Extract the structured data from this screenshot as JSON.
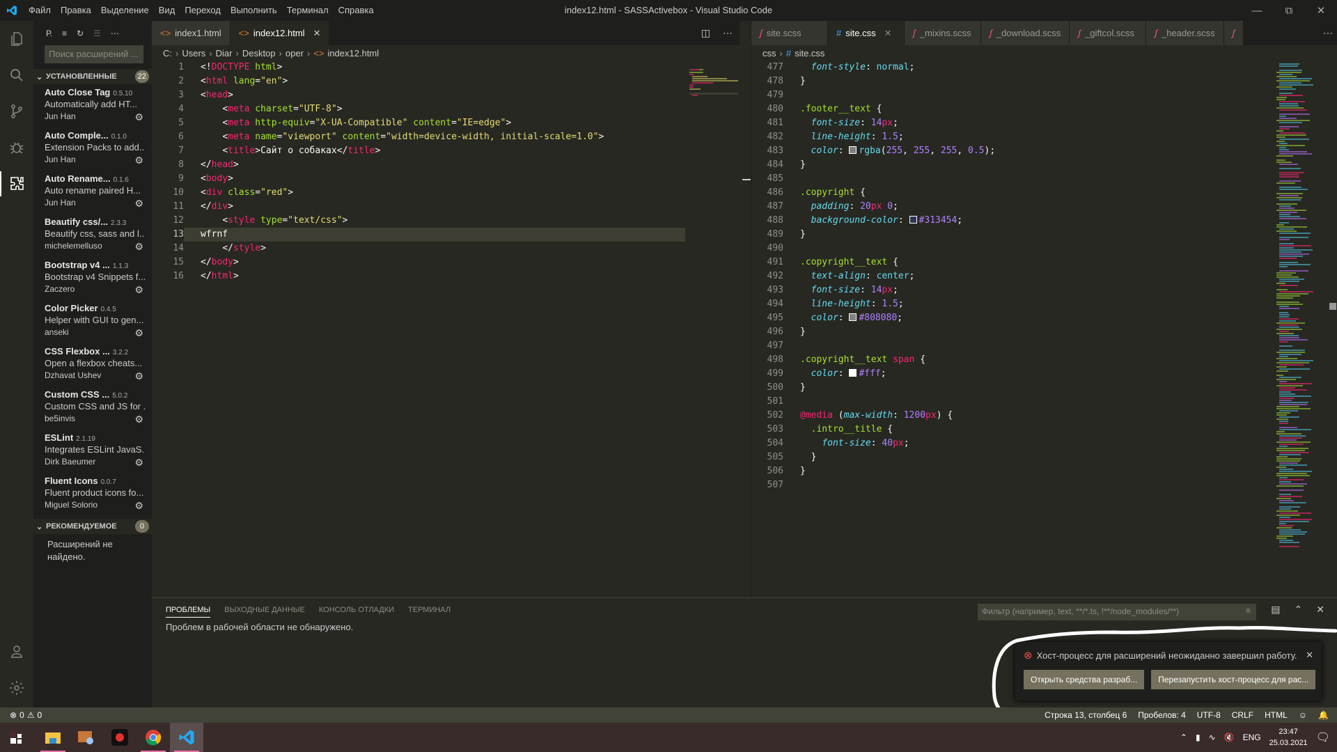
{
  "window": {
    "title": "index12.html - SASSActivebox - Visual Studio Code",
    "menu": [
      "Файл",
      "Правка",
      "Выделение",
      "Вид",
      "Переход",
      "Выполнить",
      "Терминал",
      "Справка"
    ]
  },
  "sidebar": {
    "header_label": "Р.",
    "search_placeholder": "Поиск расширений ...",
    "installed": {
      "title": "УСТАНОВЛЕННЫЕ",
      "count": "22",
      "items": [
        {
          "name": "Auto Close Tag",
          "version": "0.5.10",
          "desc": "Automatically add HT...",
          "author": "Jun Han"
        },
        {
          "name": "Auto Comple...",
          "version": "0.1.0",
          "desc": "Extension Packs to add...",
          "author": "Jun Han"
        },
        {
          "name": "Auto Rename...",
          "version": "0.1.6",
          "desc": "Auto rename paired H...",
          "author": "Jun Han"
        },
        {
          "name": "Beautify css/...",
          "version": "2.3.3",
          "desc": "Beautify css, sass and l...",
          "author": "michelemelluso"
        },
        {
          "name": "Bootstrap v4 ...",
          "version": "1.1.3",
          "desc": "Bootstrap v4 Snippets f...",
          "author": "Zaczero"
        },
        {
          "name": "Color Picker",
          "version": "0.4.5",
          "desc": "Helper with GUI to gen...",
          "author": "anseki"
        },
        {
          "name": "CSS Flexbox ...",
          "version": "3.2.2",
          "desc": "Open a flexbox cheats...",
          "author": "Dzhavat Ushev"
        },
        {
          "name": "Custom CSS ...",
          "version": "5.0.2",
          "desc": "Custom CSS and JS for ...",
          "author": "be5invis"
        },
        {
          "name": "ESLint",
          "version": "2.1.19",
          "desc": "Integrates ESLint JavaS...",
          "author": "Dirk Baeumer"
        },
        {
          "name": "Fluent Icons",
          "version": "0.0.7",
          "desc": "Fluent product icons fo...",
          "author": "Miguel Solorio"
        }
      ]
    },
    "recommended": {
      "title": "РЕКОМЕНДУЕМОЕ",
      "count": "0",
      "empty": "Расширений не найдено."
    }
  },
  "editor_left": {
    "tabs": [
      {
        "label": "index1.html",
        "active": false
      },
      {
        "label": "index12.html",
        "active": true
      }
    ],
    "breadcrumb": [
      "C:",
      "Users",
      "Diar",
      "Desktop",
      "oper",
      "index12.html"
    ],
    "current_line": 13,
    "lines": [
      {
        "n": "1",
        "html": "<span class='t-p'>&lt;!</span><span class='t-tag'>DOCTYPE</span> <span class='t-attr'>html</span><span class='t-p'>&gt;</span>"
      },
      {
        "n": "2",
        "html": "<span class='t-p'>&lt;</span><span class='t-tag'>html</span> <span class='t-attr'>lang</span><span class='t-p'>=</span><span class='t-str'>\"en\"</span><span class='t-p'>&gt;</span>"
      },
      {
        "n": "3",
        "html": "<span class='t-p'>&lt;</span><span class='t-tag'>head</span><span class='t-p'>&gt;</span>"
      },
      {
        "n": "4",
        "html": "    <span class='t-p'>&lt;</span><span class='t-tag'>meta</span> <span class='t-attr'>charset</span><span class='t-p'>=</span><span class='t-str'>\"UTF-8\"</span><span class='t-p'>&gt;</span>"
      },
      {
        "n": "5",
        "html": "    <span class='t-p'>&lt;</span><span class='t-tag'>meta</span> <span class='t-attr'>http-equiv</span><span class='t-p'>=</span><span class='t-str'>\"X-UA-Compatible\"</span> <span class='t-attr'>content</span><span class='t-p'>=</span><span class='t-str'>\"IE=edge\"</span><span class='t-p'>&gt;</span>"
      },
      {
        "n": "6",
        "html": "    <span class='t-p'>&lt;</span><span class='t-tag'>meta</span> <span class='t-attr'>name</span><span class='t-p'>=</span><span class='t-str'>\"viewport\"</span> <span class='t-attr'>content</span><span class='t-p'>=</span><span class='t-str'>\"width=device-width, initial-scale=1.0\"</span><span class='t-p'>&gt;</span>"
      },
      {
        "n": "7",
        "html": "    <span class='t-p'>&lt;</span><span class='t-tag'>title</span><span class='t-p'>&gt;</span><span class='t-txt'>Сайт о собаках</span><span class='t-p'>&lt;/</span><span class='t-tag'>title</span><span class='t-p'>&gt;</span>"
      },
      {
        "n": "8",
        "html": "<span class='t-p'>&lt;/</span><span class='t-tag'>head</span><span class='t-p'>&gt;</span>"
      },
      {
        "n": "9",
        "html": "<span class='t-p'>&lt;</span><span class='t-tag'>body</span><span class='t-p'>&gt;</span>"
      },
      {
        "n": "10",
        "html": "<span class='t-p'>&lt;</span><span class='t-tag'>div</span> <span class='t-attr'>class</span><span class='t-p'>=</span><span class='t-str'>\"red\"</span><span class='t-p'>&gt;</span>"
      },
      {
        "n": "11",
        "html": "<span class='t-p'>&lt;/</span><span class='t-tag'>div</span><span class='t-p'>&gt;</span>"
      },
      {
        "n": "12",
        "html": "    <span class='t-p'>&lt;</span><span class='t-tag'>style</span> <span class='t-attr'>type</span><span class='t-p'>=</span><span class='t-str'>\"text/css\"</span><span class='t-p'>&gt;</span>"
      },
      {
        "n": "13",
        "html": "<span class='t-txt'>wfrnf</span>"
      },
      {
        "n": "14",
        "html": "    <span class='t-p'>&lt;/</span><span class='t-tag'>style</span><span class='t-p'>&gt;</span>"
      },
      {
        "n": "15",
        "html": "<span class='t-p'>&lt;/</span><span class='t-tag'>body</span><span class='t-p'>&gt;</span>"
      },
      {
        "n": "16",
        "html": "<span class='t-p'>&lt;/</span><span class='t-tag'>html</span><span class='t-p'>&gt;</span>"
      }
    ]
  },
  "editor_right": {
    "tabs": [
      {
        "label": "site.scss",
        "type": "scss",
        "active": false
      },
      {
        "label": "site.css",
        "type": "css",
        "active": true
      },
      {
        "label": "_mixins.scss",
        "type": "scss",
        "active": false
      },
      {
        "label": "_download.scss",
        "type": "scss",
        "active": false
      },
      {
        "label": "_giftcol.scss",
        "type": "scss",
        "active": false
      },
      {
        "label": "_header.scss",
        "type": "scss",
        "active": false
      }
    ],
    "breadcrumb": [
      "css",
      "site.css"
    ],
    "lines": [
      {
        "n": "477",
        "html": "  <span class='t-prop'>font-style</span><span class='t-p'>: </span><span class='t-val'>normal</span><span class='t-p'>;</span>"
      },
      {
        "n": "478",
        "html": "<span class='t-p'>}</span>"
      },
      {
        "n": "479",
        "html": ""
      },
      {
        "n": "480",
        "html": "<span class='t-sel'>.footer__text</span> <span class='t-p'>{</span>"
      },
      {
        "n": "481",
        "html": "  <span class='t-prop'>font-size</span><span class='t-p'>: </span><span class='t-num'>14</span><span class='t-unit'>px</span><span class='t-p'>;</span>"
      },
      {
        "n": "482",
        "html": "  <span class='t-prop'>line-height</span><span class='t-p'>: </span><span class='t-num'>1.5</span><span class='t-p'>;</span>"
      },
      {
        "n": "483",
        "html": "  <span class='t-prop'>color</span><span class='t-p'>: </span><span class='swatch' style='background:#808080'></span><span class='t-val'>rgba</span><span class='t-p'>(</span><span class='t-num'>255</span><span class='t-p'>, </span><span class='t-num'>255</span><span class='t-p'>, </span><span class='t-num'>255</span><span class='t-p'>, </span><span class='t-num'>0.5</span><span class='t-p'>);</span>"
      },
      {
        "n": "484",
        "html": "<span class='t-p'>}</span>"
      },
      {
        "n": "485",
        "html": ""
      },
      {
        "n": "486",
        "html": "<span class='t-sel'>.copyright</span> <span class='t-p'>{</span>"
      },
      {
        "n": "487",
        "html": "  <span class='t-prop'>padding</span><span class='t-p'>: </span><span class='t-num'>20</span><span class='t-unit'>px</span> <span class='t-num'>0</span><span class='t-p'>;</span>"
      },
      {
        "n": "488",
        "html": "  <span class='t-prop'>background-color</span><span class='t-p'>: </span><span class='swatch' style='background:#313454'></span><span class='t-num'>#313454</span><span class='t-p'>;</span>"
      },
      {
        "n": "489",
        "html": "<span class='t-p'>}</span>"
      },
      {
        "n": "490",
        "html": ""
      },
      {
        "n": "491",
        "html": "<span class='t-sel'>.copyright__text</span> <span class='t-p'>{</span>"
      },
      {
        "n": "492",
        "html": "  <span class='t-prop'>text-align</span><span class='t-p'>: </span><span class='t-val'>center</span><span class='t-p'>;</span>"
      },
      {
        "n": "493",
        "html": "  <span class='t-prop'>font-size</span><span class='t-p'>: </span><span class='t-num'>14</span><span class='t-unit'>px</span><span class='t-p'>;</span>"
      },
      {
        "n": "494",
        "html": "  <span class='t-prop'>line-height</span><span class='t-p'>: </span><span class='t-num'>1.5</span><span class='t-p'>;</span>"
      },
      {
        "n": "495",
        "html": "  <span class='t-prop'>color</span><span class='t-p'>: </span><span class='swatch' style='background:#808080'></span><span class='t-num'>#808080</span><span class='t-p'>;</span>"
      },
      {
        "n": "496",
        "html": "<span class='t-p'>}</span>"
      },
      {
        "n": "497",
        "html": ""
      },
      {
        "n": "498",
        "html": "<span class='t-sel'>.copyright__text</span> <span class='t-tag'>span</span> <span class='t-p'>{</span>"
      },
      {
        "n": "499",
        "html": "  <span class='t-prop'>color</span><span class='t-p'>: </span><span class='swatch' style='background:#ffffff'></span><span class='t-num'>#fff</span><span class='t-p'>;</span>"
      },
      {
        "n": "500",
        "html": "<span class='t-p'>}</span>"
      },
      {
        "n": "501",
        "html": ""
      },
      {
        "n": "502",
        "html": "<span class='t-at'>@media</span> <span class='t-p'>(</span><span class='t-prop'>max-width</span><span class='t-p'>: </span><span class='t-num'>1200</span><span class='t-unit'>px</span><span class='t-p'>) {</span>"
      },
      {
        "n": "503",
        "html": "  <span class='t-sel'>.intro__title</span> <span class='t-p'>{</span>"
      },
      {
        "n": "504",
        "html": "    <span class='t-prop'>font-size</span><span class='t-p'>: </span><span class='t-num'>40</span><span class='t-unit'>px</span><span class='t-p'>;</span>"
      },
      {
        "n": "505",
        "html": "  <span class='t-p'>}</span>"
      },
      {
        "n": "506",
        "html": "<span class='t-p'>}</span>"
      },
      {
        "n": "507",
        "html": ""
      }
    ]
  },
  "panel": {
    "tabs": [
      "ПРОБЛЕМЫ",
      "ВЫХОДНЫЕ ДАННЫЕ",
      "КОНСОЛЬ ОТЛАДКИ",
      "ТЕРМИНАЛ"
    ],
    "active_tab": "ПРОБЛЕМЫ",
    "message": "Проблем в рабочей области не обнаружено.",
    "filter_placeholder": "Фильтр (например, text, **/*.ts, !**/node_modules/**)"
  },
  "notification": {
    "message": "Хост-процесс для расширений неожиданно завершил работу.",
    "buttons": [
      "Открыть средства разраб...",
      "Перезапустить хост-процесс для рас..."
    ]
  },
  "statusbar": {
    "errors": "0",
    "warnings": "0",
    "position": "Строка 13, столбец 6",
    "spaces": "Пробелов: 4",
    "encoding": "UTF-8",
    "eol": "CRLF",
    "language": "HTML"
  },
  "taskbar": {
    "lang": "ENG",
    "time": "23:47",
    "date": "25.03.2021"
  },
  "colors": {
    "accent_vscode": "#23a9f2",
    "error": "#f14c4c",
    "scss_icon": "#f55385",
    "css_icon": "#42a5f5",
    "html_icon": "#e37933"
  }
}
